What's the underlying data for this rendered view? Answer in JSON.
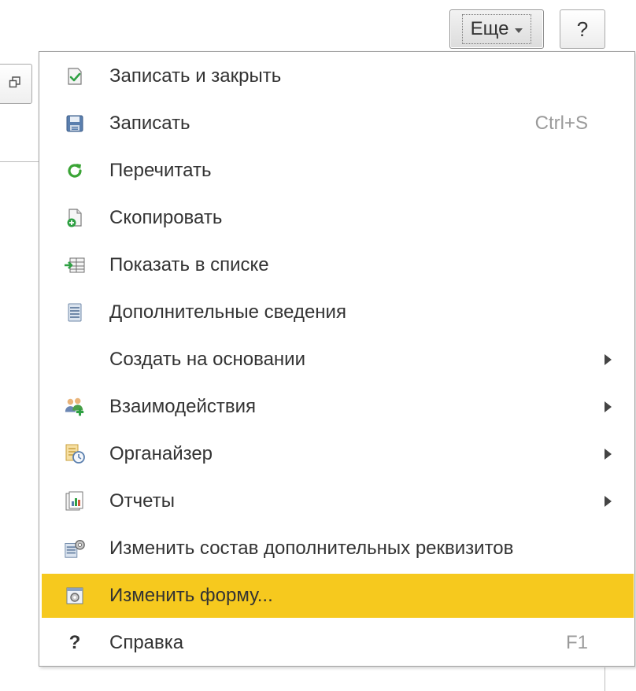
{
  "toolbar": {
    "more_label": "Еще",
    "help_label": "?"
  },
  "menu": {
    "items": [
      {
        "label": "Записать и закрыть",
        "shortcut": "",
        "icon": "save-close-check-icon",
        "submenu": false
      },
      {
        "label": "Записать",
        "shortcut": "Ctrl+S",
        "icon": "floppy-disk-icon",
        "submenu": false
      },
      {
        "label": "Перечитать",
        "shortcut": "",
        "icon": "refresh-icon",
        "submenu": false
      },
      {
        "label": "Скопировать",
        "shortcut": "",
        "icon": "copy-document-icon",
        "submenu": false
      },
      {
        "label": "Показать в списке",
        "shortcut": "",
        "icon": "show-in-list-icon",
        "submenu": false
      },
      {
        "label": "Дополнительные сведения",
        "shortcut": "",
        "icon": "additional-info-icon",
        "submenu": false
      },
      {
        "label": "Создать на основании",
        "shortcut": "",
        "icon": "",
        "submenu": true
      },
      {
        "label": "Взаимодействия",
        "shortcut": "",
        "icon": "interactions-users-icon",
        "submenu": true
      },
      {
        "label": "Органайзер",
        "shortcut": "",
        "icon": "organizer-clock-icon",
        "submenu": true
      },
      {
        "label": "Отчеты",
        "shortcut": "",
        "icon": "reports-chart-icon",
        "submenu": true
      },
      {
        "label": "Изменить состав дополнительных реквизитов",
        "shortcut": "",
        "icon": "edit-attributes-gear-icon",
        "submenu": false
      },
      {
        "label": "Изменить форму...",
        "shortcut": "",
        "icon": "change-form-icon",
        "submenu": false,
        "highlighted": true
      },
      {
        "label": "Справка",
        "shortcut": "F1",
        "icon": "question-mark-icon",
        "submenu": false
      }
    ]
  },
  "colors": {
    "highlight": "#f6c91e",
    "shortcut_text": "#9a9a9a",
    "text": "#333333"
  }
}
